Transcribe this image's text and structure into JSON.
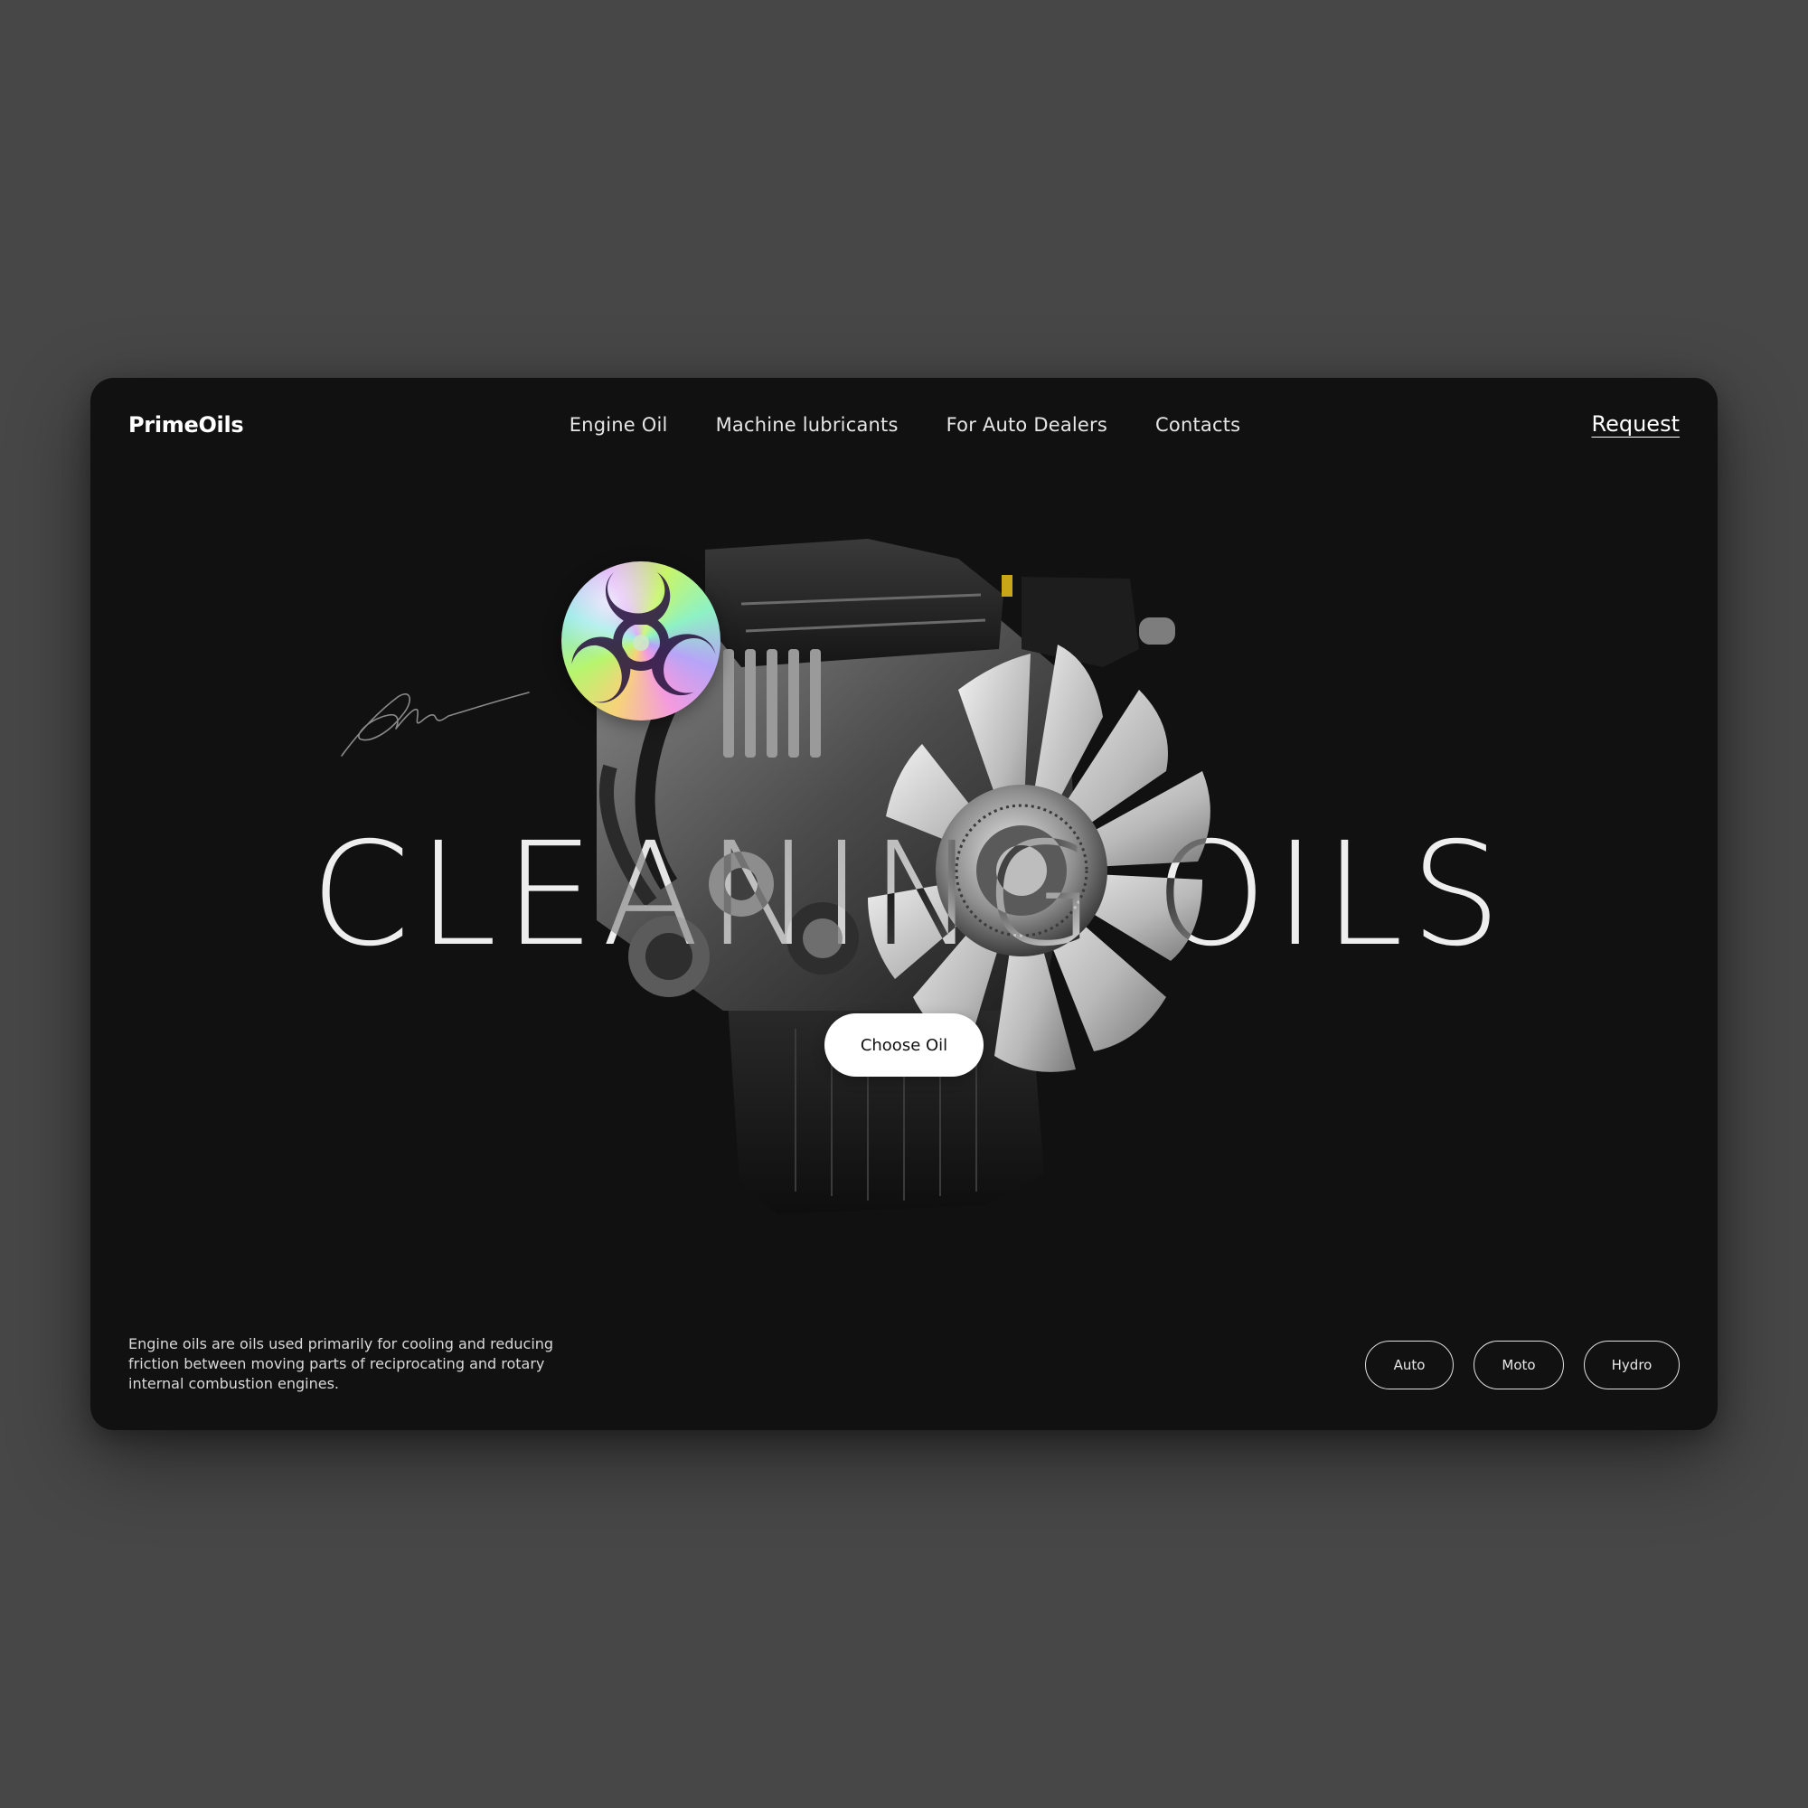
{
  "brand": {
    "name": "PrimeOils"
  },
  "nav": {
    "items": [
      {
        "label": "Engine Oil"
      },
      {
        "label": "Machine lubricants"
      },
      {
        "label": "For Auto Dealers"
      },
      {
        "label": "Contacts"
      }
    ]
  },
  "header": {
    "request_label": "Request"
  },
  "hero": {
    "headline": "CLEANING OILS",
    "cta_label": "Choose Oil",
    "badge_icon": "biohazard-icon",
    "signature": "handwritten-signature",
    "image": "engine-image"
  },
  "footer": {
    "description": "Engine oils are oils used primarily for cooling and reducing friction between moving parts of reciprocating and rotary internal combustion engines.",
    "categories": [
      {
        "label": "Auto"
      },
      {
        "label": "Moto"
      },
      {
        "label": "Hydro"
      }
    ]
  },
  "colors": {
    "page_background": "#474747",
    "card_background": "#111111",
    "text": "#ffffff",
    "button_background": "#ffffff"
  }
}
